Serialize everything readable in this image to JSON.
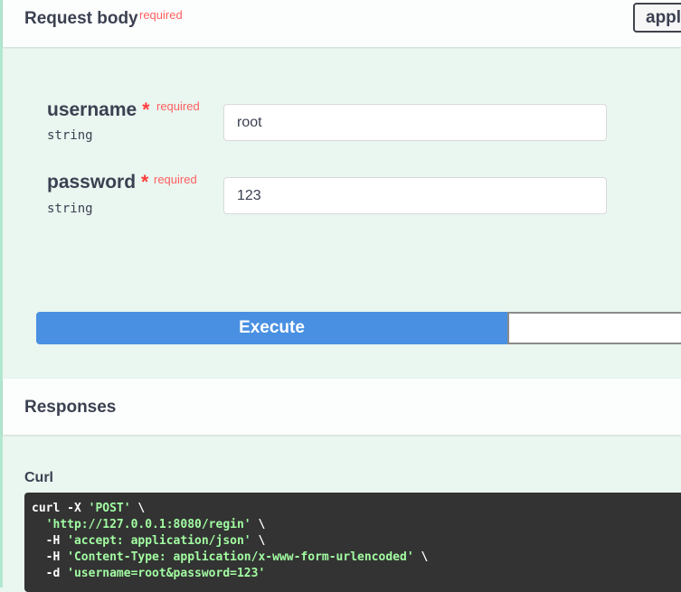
{
  "request_body": {
    "title": "Request body",
    "required_label": "required",
    "content_type": "appli"
  },
  "params": [
    {
      "name": "username",
      "star": "*",
      "required_label": "required",
      "type": "string",
      "value": "root"
    },
    {
      "name": "password",
      "star": "*",
      "required_label": "required",
      "type": "string",
      "value": "123"
    }
  ],
  "execute": {
    "label": "Execute"
  },
  "responses": {
    "title": "Responses",
    "curl_label": "Curl",
    "curl": {
      "line1_cmd": "curl -X ",
      "line1_str": "'POST'",
      "line1_tail": " \\",
      "line2_str": "'http://127.0.0.1:8080/regin'",
      "line2_tail": " \\",
      "line3_flag": "-H ",
      "line3_str": "'accept: application/json'",
      "line3_tail": " \\",
      "line4_flag": "-H ",
      "line4_str": "'Content-Type: application/x-www-form-urlencoded'",
      "line4_tail": " \\",
      "line5_flag": "-d ",
      "line5_str": "'username=root&password=123'"
    }
  }
}
